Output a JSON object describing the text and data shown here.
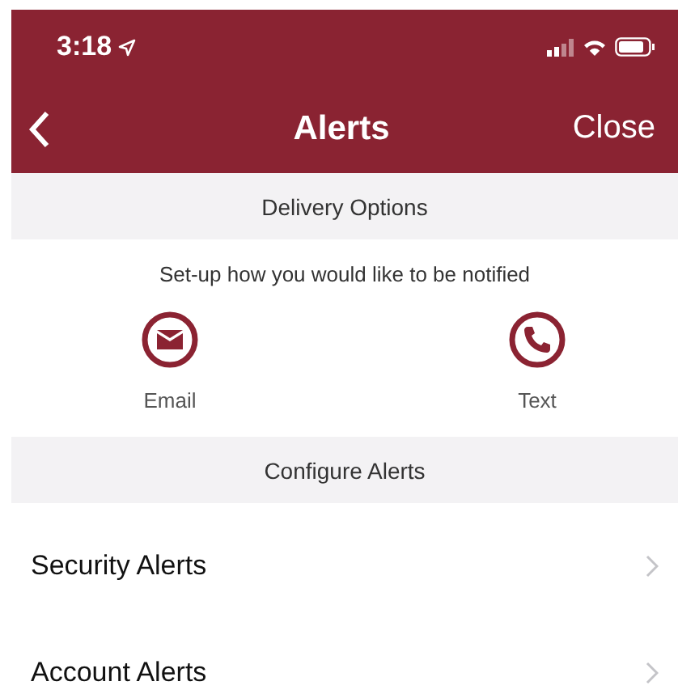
{
  "status_bar": {
    "time": "3:18"
  },
  "nav": {
    "title": "Alerts",
    "close": "Close"
  },
  "delivery": {
    "header": "Delivery Options",
    "subtitle": "Set-up how you would like to be notified",
    "options": [
      {
        "kind": "email",
        "label": "Email"
      },
      {
        "kind": "phone",
        "label": "Text"
      }
    ]
  },
  "configure": {
    "header": "Configure Alerts",
    "items": [
      {
        "label": "Security Alerts"
      },
      {
        "label": "Account Alerts"
      }
    ]
  }
}
